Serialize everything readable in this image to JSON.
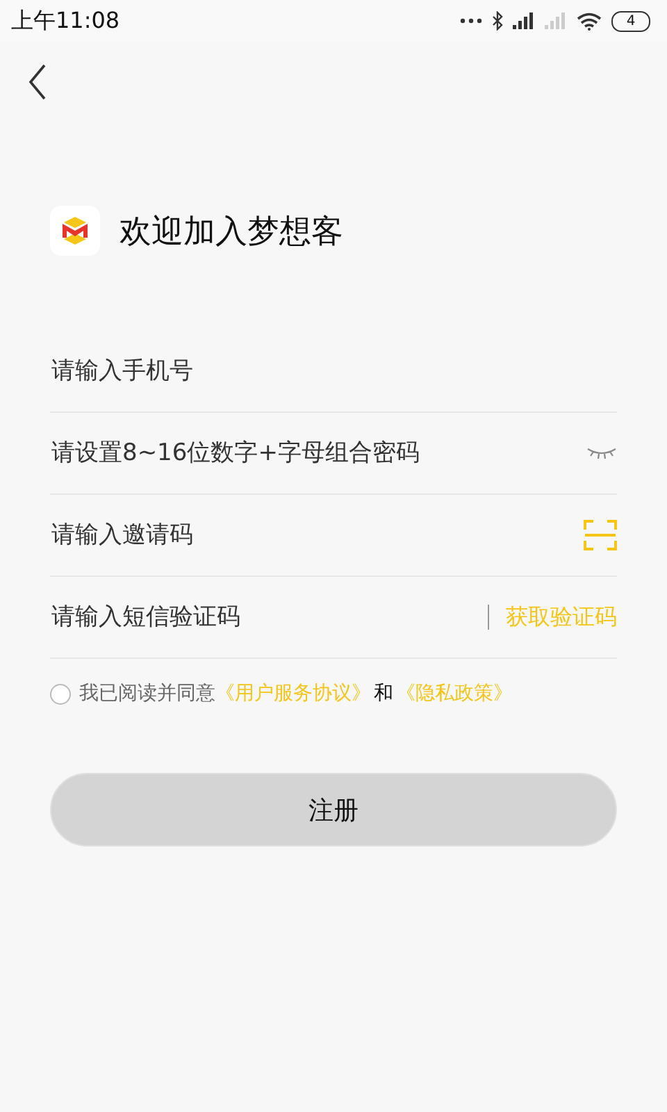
{
  "status_bar": {
    "time": "上午11:08",
    "battery": "4"
  },
  "title": "欢迎加入梦想客",
  "fields": [
    {
      "placeholder": "请输入手机号",
      "kind": "plain"
    },
    {
      "placeholder": "请设置8~16位数字+字母组合密码",
      "kind": "password"
    },
    {
      "placeholder": "请输入邀请码",
      "kind": "scan"
    },
    {
      "placeholder": "请输入短信验证码",
      "kind": "code",
      "action": "获取验证码"
    }
  ],
  "agreement": {
    "checked": false,
    "text": "我已阅读并同意",
    "link_1": "《用户服务协议》",
    "joiner": "和",
    "link_2": "《隐私政策》"
  },
  "submit": {
    "label": "注册",
    "disabled": true
  }
}
